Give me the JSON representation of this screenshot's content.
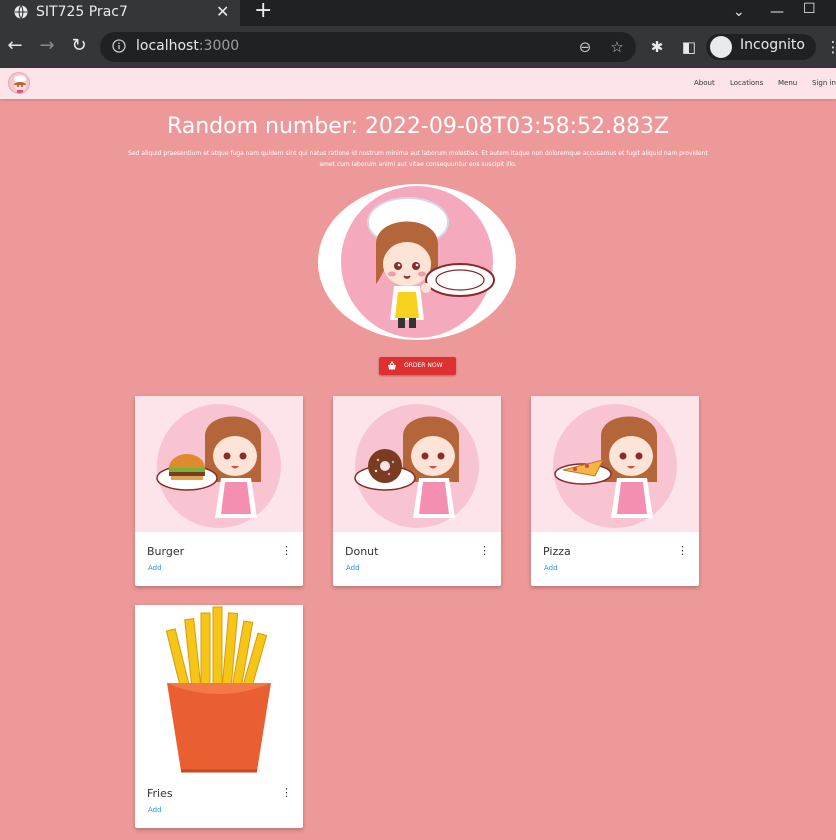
{
  "browser": {
    "tab_title": "SIT725 Prac7",
    "url_host": "localhost",
    "url_port": ":3000",
    "profile_label": "Incognito"
  },
  "nav": {
    "links": [
      "About",
      "Locations",
      "Menu",
      "Sign in"
    ]
  },
  "hero": {
    "title": "Random number: 2022-09-08T03:58:52.883Z",
    "text": "Sed aliquid praesentium et atque fuga nam quidem sint qui natus ratione id nostrum minima aut laborum molestias. Et autem itaque non doloremque accusamus et fugit aliquid nam provident amet cum laborum animi aut vitae consequuntur eos suscipit illo.",
    "button_label": "ORDER NOW"
  },
  "cards": [
    {
      "title": "Burger",
      "action": "Add",
      "food": "burger"
    },
    {
      "title": "Donut",
      "action": "Add",
      "food": "donut"
    },
    {
      "title": "Pizza",
      "action": "Add",
      "food": "pizza"
    },
    {
      "title": "Fries",
      "action": "Add",
      "food": "fries"
    }
  ],
  "colors": {
    "page_background": "#ee9999",
    "nav_background": "#fde4ea",
    "button": "#dd3131",
    "link": "#2196f3"
  }
}
